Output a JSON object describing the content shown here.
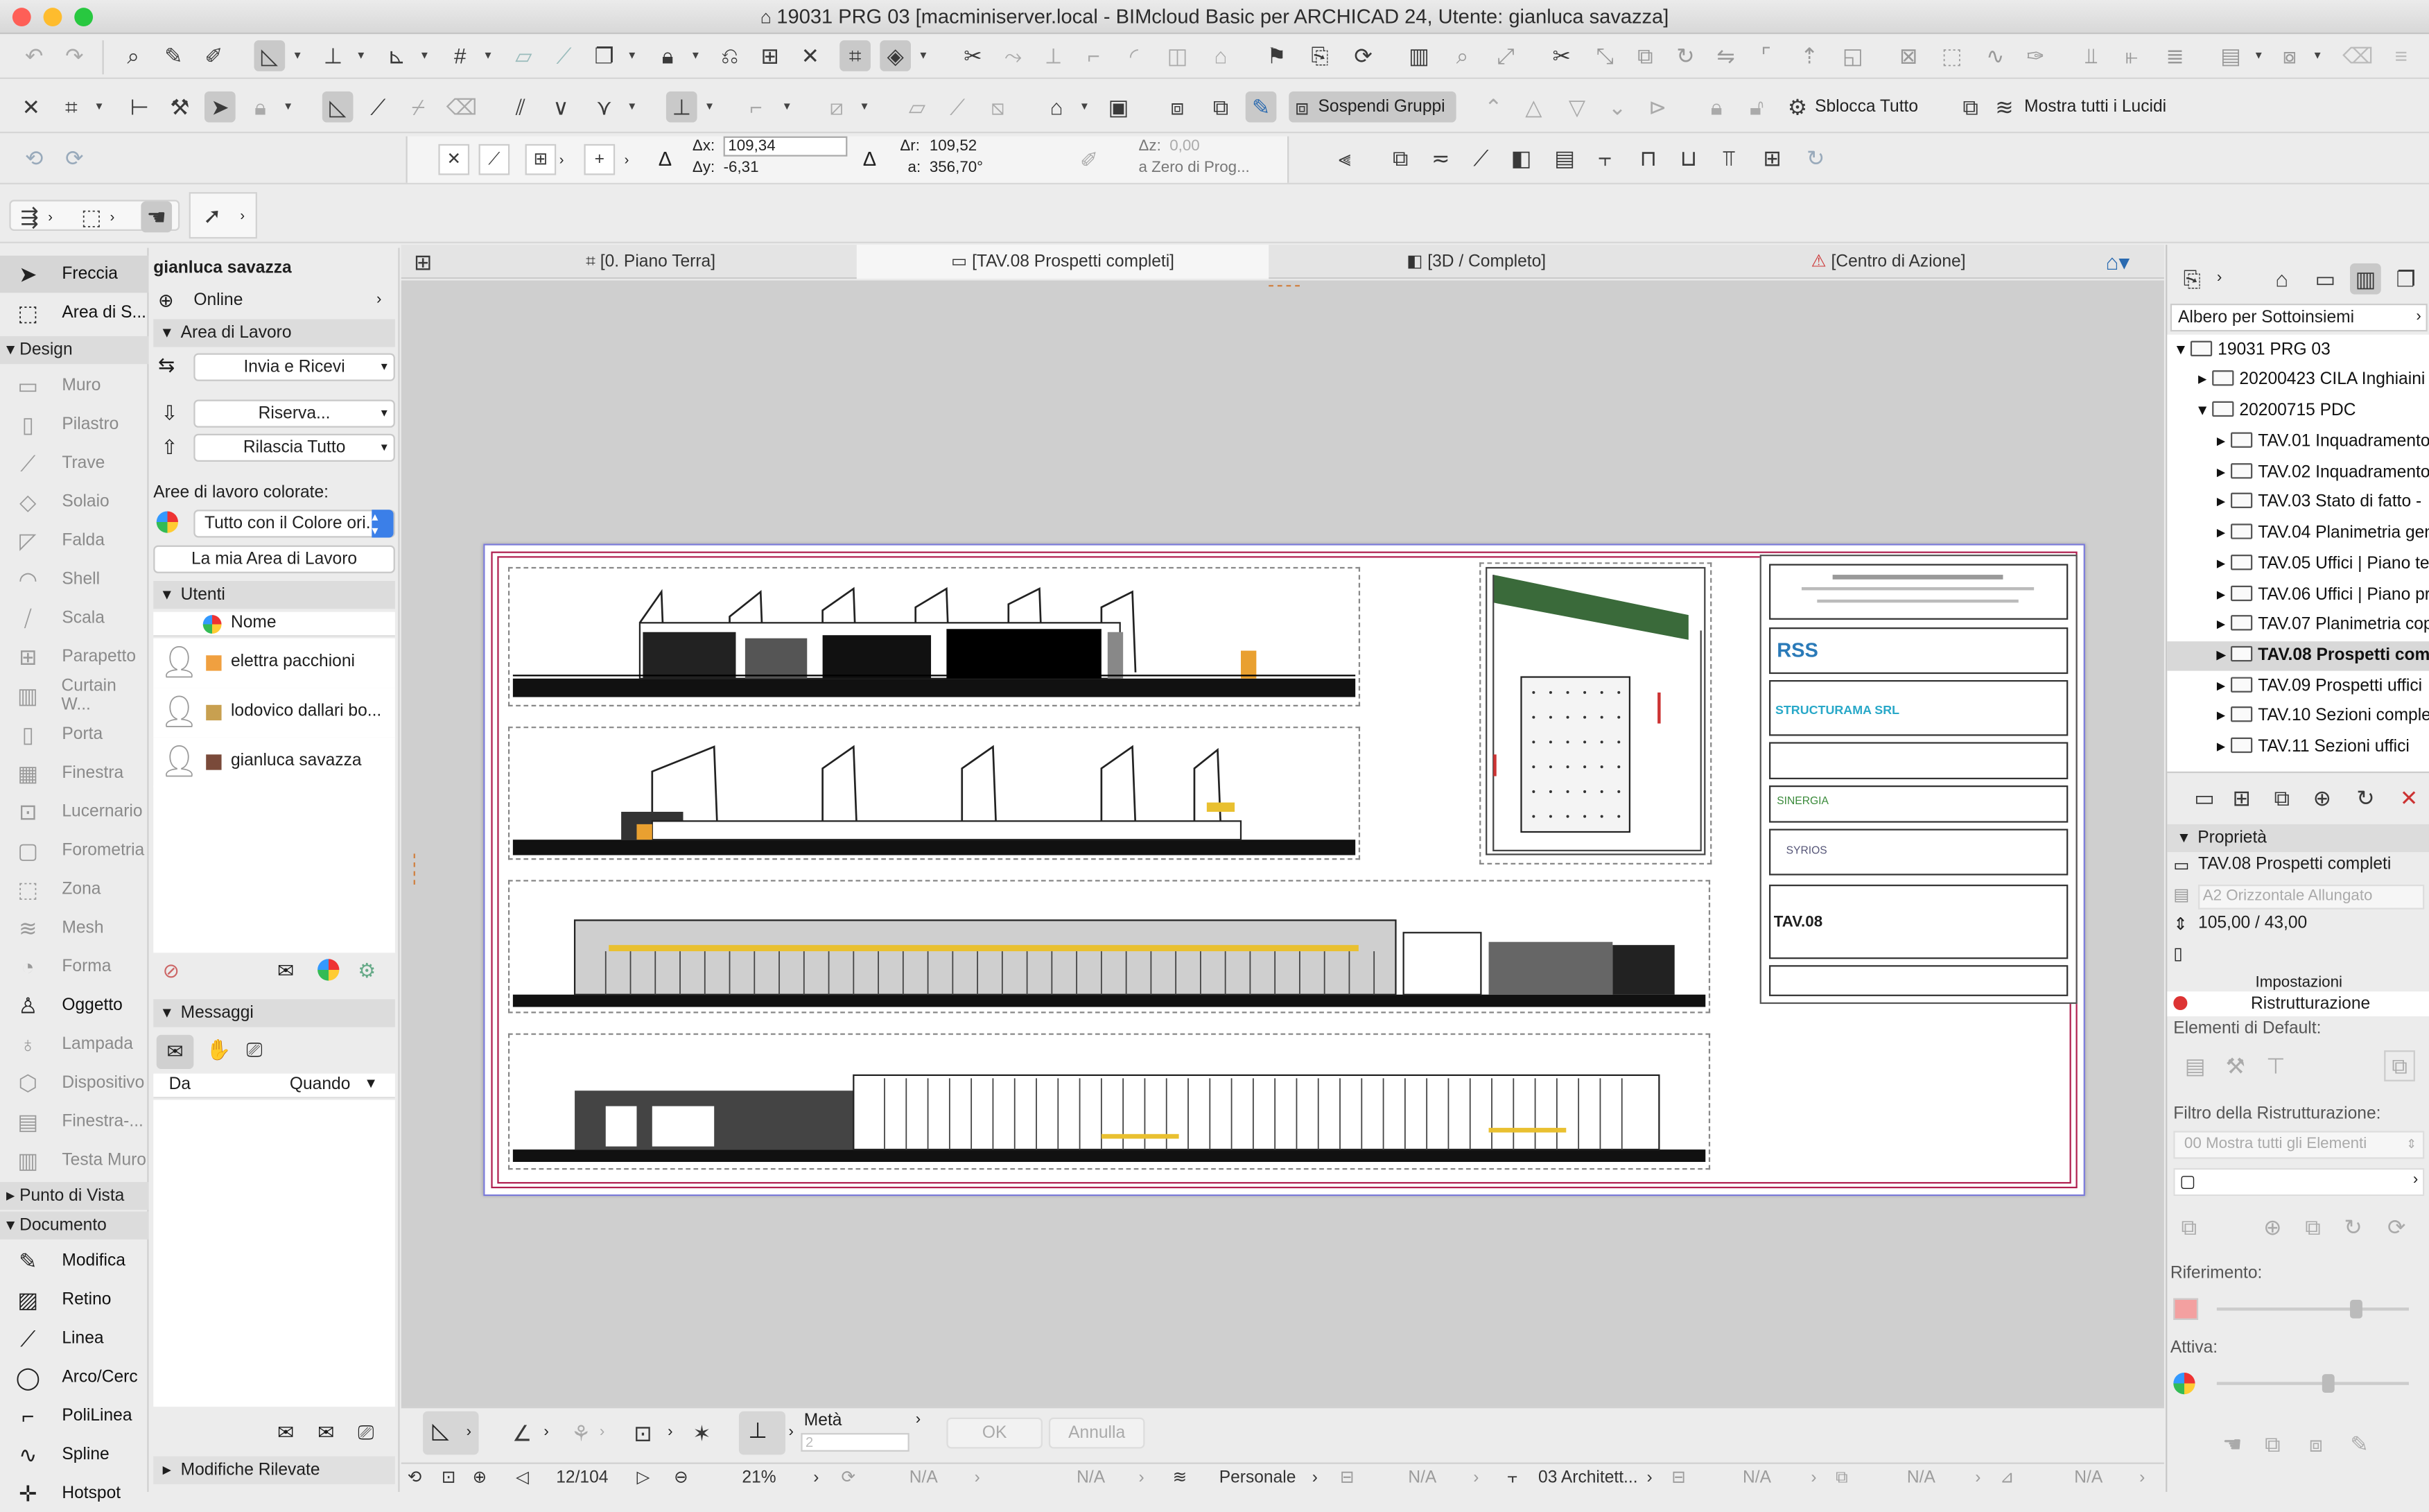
{
  "window": {
    "title": "19031 PRG 03 [macminiserver.local - BIMcloud Basic per ARCHICAD 24, Utente: gianluca savazza]"
  },
  "toolbar": {
    "suspend_groups": "Sospendi Gruppi",
    "unlock_all": "Sblocca Tutto",
    "show_all_tracing": "Mostra tutti i Lucidi"
  },
  "coords": {
    "dx_label": "Δx:",
    "dx": "109,34",
    "dy_label": "Δy:",
    "dy": "-6,31",
    "dr_label": "Δr:",
    "dr": "109,52",
    "a_label": "a:",
    "a": "356,70°",
    "dz_label": "Δz:",
    "dz": "0,00",
    "ref": "a Zero di Prog..."
  },
  "toolbox": {
    "arrow": "Freccia",
    "marquee": "Area di S...",
    "design": "Design",
    "tools": [
      "Muro",
      "Pilastro",
      "Trave",
      "Solaio",
      "Falda",
      "Shell",
      "Scala",
      "Parapetto",
      "Curtain W...",
      "Porta",
      "Finestra",
      "Lucernario",
      "Forometria",
      "Zona",
      "Mesh",
      "Forma",
      "Oggetto",
      "Lampada",
      "Dispositivo",
      "Finestra-...",
      "Testa Muro"
    ],
    "viewpoint": "Punto di Vista",
    "document": "Documento",
    "doc_tools": [
      "Modifica",
      "Retino",
      "Linea",
      "Arco/Cerc",
      "PoliLinea",
      "Spline",
      "Hotspot"
    ]
  },
  "team": {
    "user": "gianluca savazza",
    "status": "Online",
    "workspace": "Area di Lavoro",
    "send_receive": "Invia e Ricevi",
    "reserve": "Riserva...",
    "release_all": "Rilascia Tutto",
    "colored_label": "Aree di lavoro colorate:",
    "colored_value": "Tutto con il Colore ori...",
    "my_workspace": "La mia Area di Lavoro",
    "users_head": "Utenti",
    "name_col": "Nome",
    "users": [
      {
        "name": "elettra pacchioni",
        "color": "#f0a040"
      },
      {
        "name": "lodovico dallari bo...",
        "color": "#c8a050"
      },
      {
        "name": "gianluca savazza",
        "color": "#7a4a3a"
      }
    ],
    "messages_head": "Messaggi",
    "from_col": "Da",
    "when_col": "Quando",
    "changes": "Modifiche Rilevate"
  },
  "tabs": [
    "[0. Piano Terra]",
    "[TAV.08 Prospetti completi]",
    "[3D / Completo]",
    "[Centro di Azione]"
  ],
  "sheet": {
    "company1": "RSS",
    "company2": "STRUCTURAMA SRL",
    "company3": "SINERGIA",
    "company4": "SYRIOS",
    "sheet_code": "TAV.08"
  },
  "navigator": {
    "mode": "Albero per Sottoinsiemi",
    "root": "19031 PRG 03",
    "folders": [
      "20200423 CILA Inghiaini",
      "20200715 PDC"
    ],
    "items": [
      "TAV.01 Inquadramento",
      "TAV.02 Inquadramento",
      "TAV.03 Stato di fatto -",
      "TAV.04 Planimetria gen",
      "TAV.05 Uffici | Piano te",
      "TAV.06 Uffici | Piano pr",
      "TAV.07 Planimetria cop",
      "TAV.08 Prospetti com",
      "TAV.09 Prospetti uffici",
      "TAV.10 Sezioni complet",
      "TAV.11 Sezioni uffici"
    ],
    "props_head": "Proprietà",
    "prop_name": "TAV.08  Prospetti completi",
    "prop_format": "A2 Orizzontale Allungato",
    "prop_size": "105,00 / 43,00",
    "settings": "Impostazioni",
    "renovation": "Ristrutturazione",
    "default_elements": "Elementi di Default:",
    "filter_label": "Filtro della Ristrutturazione:",
    "filter_value": "00 Mostra tutti gli Elementi",
    "reference": "Riferimento:",
    "active": "Attiva:"
  },
  "bottom": {
    "half": "Metà",
    "half_val": "2",
    "ok": "OK",
    "cancel": "Annulla",
    "page": "12/104",
    "zoom": "21%",
    "na": "N/A",
    "personal": "Personale",
    "layer": "03 Architett..."
  }
}
